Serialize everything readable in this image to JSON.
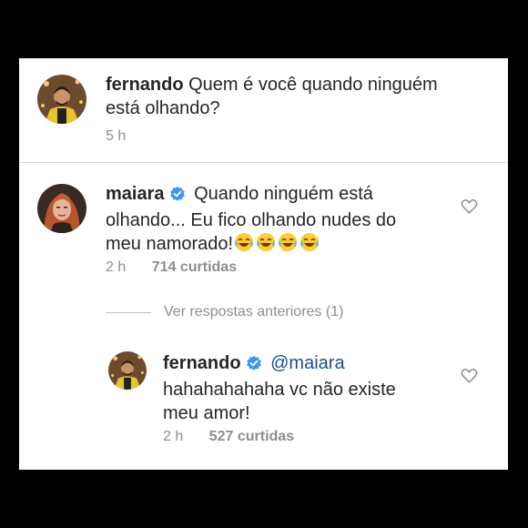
{
  "comments": [
    {
      "username": "fernando",
      "text_line1": "Quem é você quando ninguém",
      "text_line2": "está olhando?",
      "time": "5 h"
    },
    {
      "username": "maiara",
      "text_line1": "Quando ninguém está",
      "text_line2": "olhando... Eu fico olhando nudes do",
      "text_line3": "meu namorado!",
      "emoji": "😂😂😂😂",
      "time": "2 h",
      "likes": "714 curtidas"
    }
  ],
  "view_replies": "Ver respostas anteriores (1)",
  "reply": {
    "username": "fernando",
    "mention": "@maiara",
    "text_line1": "hahahahahaha vc não existe",
    "text_line2": "meu amor!",
    "time": "2 h",
    "likes": "527 curtidas"
  },
  "colors": {
    "background": "#000000",
    "card": "#ffffff",
    "text": "#262626",
    "meta": "#8e8e8e",
    "verified": "#3897f0",
    "mention": "#1a4f8a"
  },
  "icons": [
    "verified-badge-icon",
    "heart-icon",
    "laughing-emoji"
  ]
}
